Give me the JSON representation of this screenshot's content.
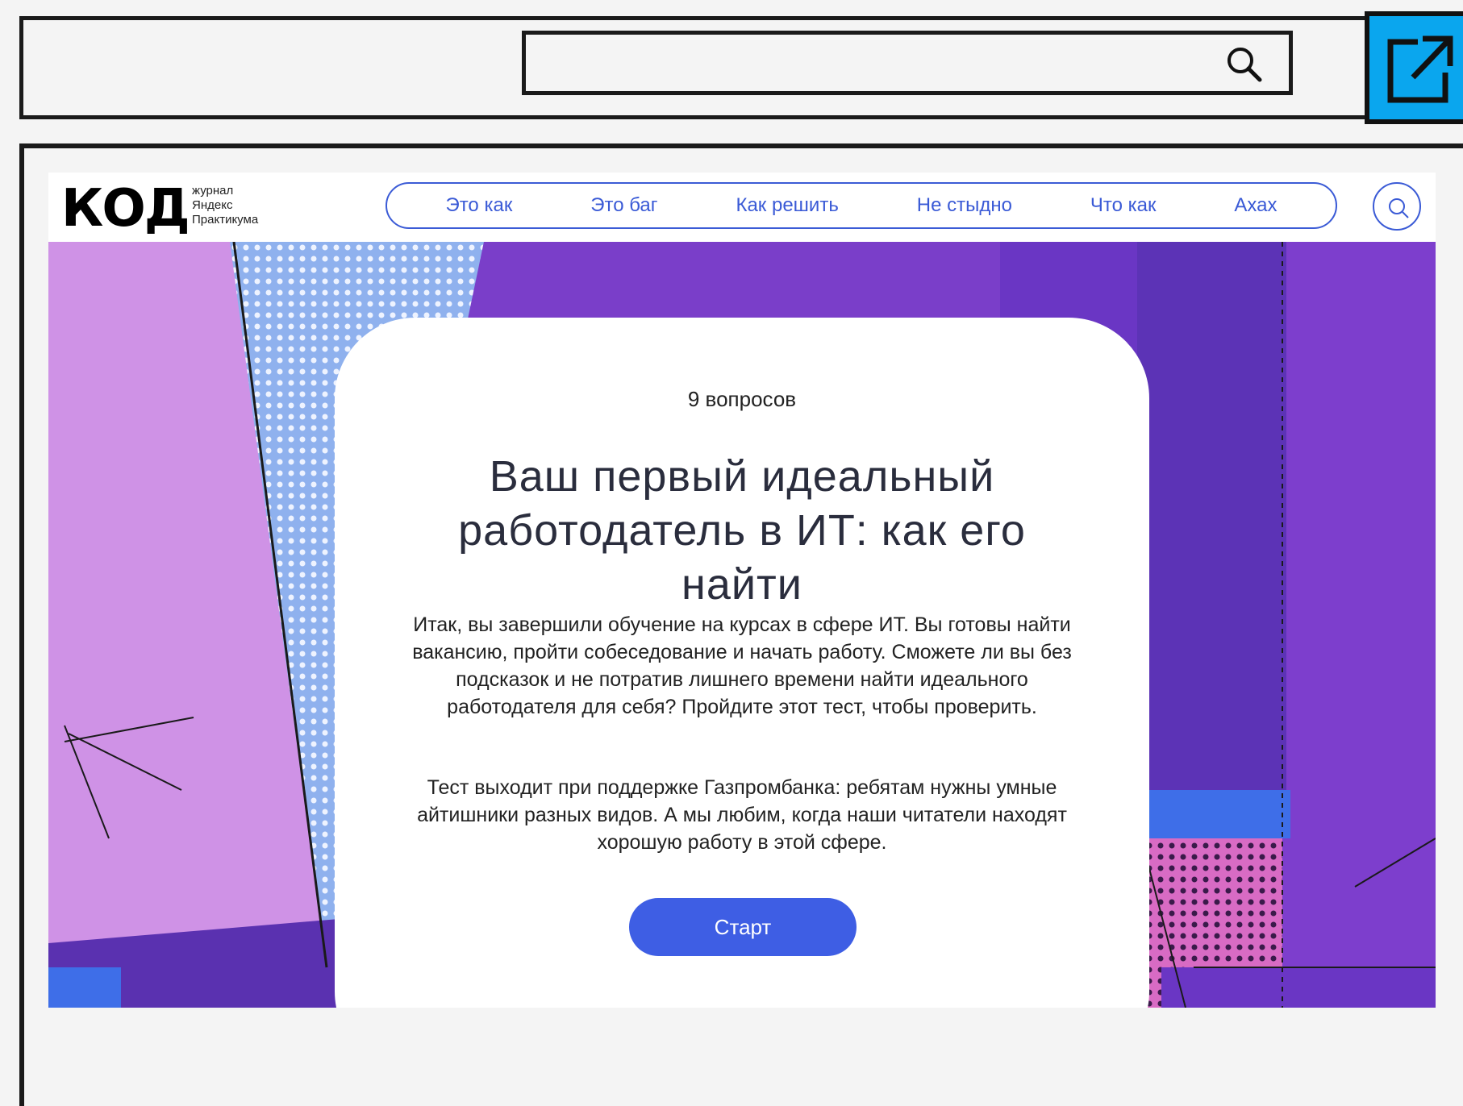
{
  "site": {
    "logo_text": "КОД",
    "logo_sub": [
      "журнал",
      "Яндекс",
      "Практикума"
    ],
    "nav": [
      "Это как",
      "Это баг",
      "Как решить",
      "Не стыдно",
      "Что как",
      "Ахах"
    ]
  },
  "quiz": {
    "count": "9 вопросов",
    "title": "Ваш первый идеальный работодатель в ИТ: как его найти",
    "intro": "Итак, вы завершили обучение на курсах в сфере ИТ. Вы готовы найти вакансию, пройти собеседование и начать работу. Сможете ли вы без подсказок и не потратив лишнего времени найти идеального работодателя для себя? Пройдите этот тест, чтобы проверить.",
    "sponsor": "Тест выходит при поддержке Газпромбанка: ребятам нужны умные айтишники разных видов. А мы любим, когда наши читатели находят хорошую работу в этой сфере.",
    "start_label": "Старт"
  },
  "colors": {
    "accent": "#3e5ee4",
    "nav_blue": "#3a5ad6",
    "external_button": "#0aa6ee",
    "hero_violet": "#7a3ec9",
    "hero_lilac": "#cc90e6"
  },
  "icons": {
    "toolbar_search": "search-icon",
    "external": "external-link-icon",
    "site_search": "search-icon"
  }
}
